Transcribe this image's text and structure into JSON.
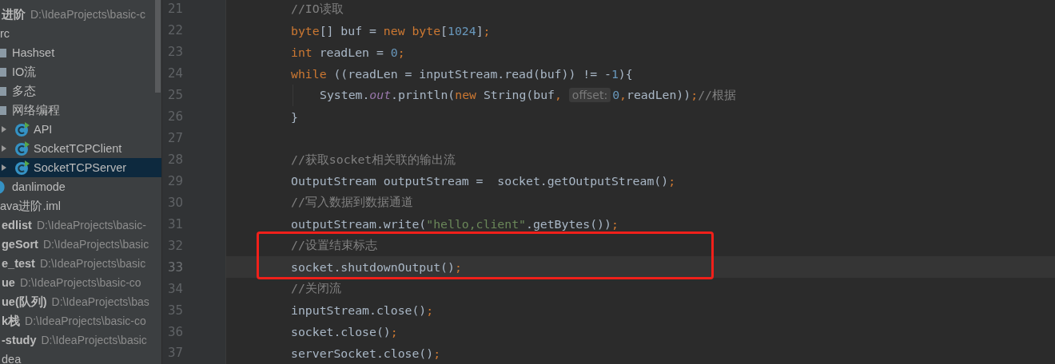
{
  "project_tree": [
    {
      "name": "进阶",
      "kind": "module",
      "path": "D:\\IdeaProjects\\basic-c",
      "selected": false,
      "children": [
        {
          "name": "rc",
          "selected": false,
          "children": [
            {
              "name": "Hashset",
              "kind": "folder",
              "selected": false
            },
            {
              "name": "IO流",
              "kind": "folder",
              "selected": false
            },
            {
              "name": "多态",
              "kind": "folder",
              "selected": false
            },
            {
              "name": "网络编程",
              "kind": "folder",
              "selected": false,
              "children": [
                {
                  "name": "API",
                  "kind": "class",
                  "expanded": false,
                  "selected": false
                },
                {
                  "name": "SocketTCPClient",
                  "kind": "class",
                  "expanded": false,
                  "selected": false
                },
                {
                  "name": "SocketTCPServer",
                  "kind": "class",
                  "expanded": false,
                  "selected": true
                }
              ]
            },
            {
              "name": "danlimode",
              "kind": "class-cut",
              "selected": false
            }
          ]
        },
        {
          "name": "ava进阶.iml",
          "selected": false
        }
      ]
    },
    {
      "name": "edlist",
      "kind": "module",
      "path": "D:\\IdeaProjects\\basic-",
      "selected": false
    },
    {
      "name": "geSort",
      "kind": "module",
      "path": "D:\\IdeaProjects\\basic",
      "selected": false
    },
    {
      "name": "e_test",
      "kind": "module",
      "path": "D:\\IdeaProjects\\basic",
      "selected": false
    },
    {
      "name": "ue",
      "kind": "module",
      "path": "D:\\IdeaProjects\\basic-co",
      "selected": false
    },
    {
      "name": "ue(队列)",
      "kind": "module",
      "path": "D:\\IdeaProjects\\bas",
      "selected": false
    },
    {
      "name": "k栈",
      "kind": "module",
      "path": "D:\\IdeaProjects\\basic-co",
      "selected": false
    },
    {
      "name": "-study",
      "kind": "module",
      "path": "D:\\IdeaProjects\\basic",
      "selected": false
    },
    {
      "name": "dea",
      "selected": false
    }
  ],
  "editor": {
    "lines": [
      {
        "number": "21",
        "current": false,
        "boxed": false,
        "nested": false,
        "tokens": [
          {
            "kind": "comment",
            "text": "//IO读取"
          }
        ]
      },
      {
        "number": "22",
        "current": false,
        "boxed": false,
        "nested": false,
        "tokens": [
          {
            "kind": "keyword",
            "text": "byte"
          },
          {
            "kind": "plain",
            "text": "[] buf = "
          },
          {
            "kind": "keyword",
            "text": "new byte"
          },
          {
            "kind": "plain",
            "text": "["
          },
          {
            "kind": "number",
            "text": "1024"
          },
          {
            "kind": "plain",
            "text": "]"
          },
          {
            "kind": "keyword",
            "text": ";"
          }
        ]
      },
      {
        "number": "23",
        "current": false,
        "boxed": false,
        "nested": false,
        "tokens": [
          {
            "kind": "keyword",
            "text": "int "
          },
          {
            "kind": "plain",
            "text": "readLen = "
          },
          {
            "kind": "number",
            "text": "0"
          },
          {
            "kind": "keyword",
            "text": ";"
          }
        ]
      },
      {
        "number": "24",
        "current": false,
        "boxed": false,
        "nested": false,
        "tokens": [
          {
            "kind": "keyword",
            "text": "while "
          },
          {
            "kind": "plain",
            "text": "((readLen = inputStream.read(buf)) != -"
          },
          {
            "kind": "number",
            "text": "1"
          },
          {
            "kind": "plain",
            "text": "){"
          }
        ]
      },
      {
        "number": "25",
        "current": false,
        "boxed": false,
        "nested": true,
        "tokens": [
          {
            "kind": "plain",
            "text": "System."
          },
          {
            "kind": "field",
            "text": "out"
          },
          {
            "kind": "plain",
            "text": ".println("
          },
          {
            "kind": "keyword",
            "text": "new "
          },
          {
            "kind": "plain",
            "text": "String(buf"
          },
          {
            "kind": "keyword",
            "text": ", "
          },
          {
            "kind": "hint",
            "text": "offset:"
          },
          {
            "kind": "number",
            "text": "0"
          },
          {
            "kind": "keyword",
            "text": ","
          },
          {
            "kind": "plain",
            "text": "readLen))"
          },
          {
            "kind": "keyword",
            "text": ";"
          },
          {
            "kind": "comment",
            "text": "//根据"
          }
        ]
      },
      {
        "number": "26",
        "current": false,
        "boxed": false,
        "nested": false,
        "tokens": [
          {
            "kind": "plain",
            "text": "}"
          }
        ]
      },
      {
        "number": "27",
        "current": false,
        "boxed": false,
        "nested": false
      },
      {
        "number": "28",
        "current": false,
        "boxed": false,
        "nested": false,
        "tokens": [
          {
            "kind": "comment",
            "text": "//获取socket相关联的输出流"
          }
        ]
      },
      {
        "number": "29",
        "current": false,
        "boxed": false,
        "nested": false,
        "tokens": [
          {
            "kind": "plain",
            "text": "OutputStream outputStream =  socket.getOutputStream()"
          },
          {
            "kind": "keyword",
            "text": ";"
          }
        ]
      },
      {
        "number": "30",
        "current": false,
        "boxed": false,
        "nested": false,
        "tokens": [
          {
            "kind": "comment",
            "text": "//写入数据到数据通道"
          }
        ]
      },
      {
        "number": "31",
        "current": false,
        "boxed": false,
        "nested": false,
        "tokens": [
          {
            "kind": "plain",
            "text": "outputStream.write("
          },
          {
            "kind": "string",
            "text": "\"hello,client\""
          },
          {
            "kind": "plain",
            "text": ".getBytes())"
          },
          {
            "kind": "keyword",
            "text": ";"
          }
        ]
      },
      {
        "number": "32",
        "current": false,
        "boxed": true,
        "nested": false,
        "tokens": [
          {
            "kind": "comment",
            "text": "//设置结束标志"
          }
        ]
      },
      {
        "number": "33",
        "current": true,
        "boxed": true,
        "nested": false,
        "tokens": [
          {
            "kind": "plain",
            "text": "socket.shutdownOutput()"
          },
          {
            "kind": "keyword",
            "text": ";"
          }
        ]
      },
      {
        "number": "34",
        "current": false,
        "boxed": false,
        "nested": false,
        "tokens": [
          {
            "kind": "comment",
            "text": "//关闭流"
          }
        ]
      },
      {
        "number": "35",
        "current": false,
        "boxed": false,
        "nested": false,
        "tokens": [
          {
            "kind": "plain",
            "text": "inputStream.close()"
          },
          {
            "kind": "keyword",
            "text": ";"
          }
        ]
      },
      {
        "number": "36",
        "current": false,
        "boxed": false,
        "nested": false,
        "tokens": [
          {
            "kind": "plain",
            "text": "socket.close()"
          },
          {
            "kind": "keyword",
            "text": ";"
          }
        ]
      },
      {
        "number": "37",
        "current": false,
        "boxed": false,
        "nested": false,
        "tokens": [
          {
            "kind": "plain",
            "text": "serverSocket.close()"
          },
          {
            "kind": "keyword",
            "text": ";"
          }
        ]
      }
    ]
  }
}
